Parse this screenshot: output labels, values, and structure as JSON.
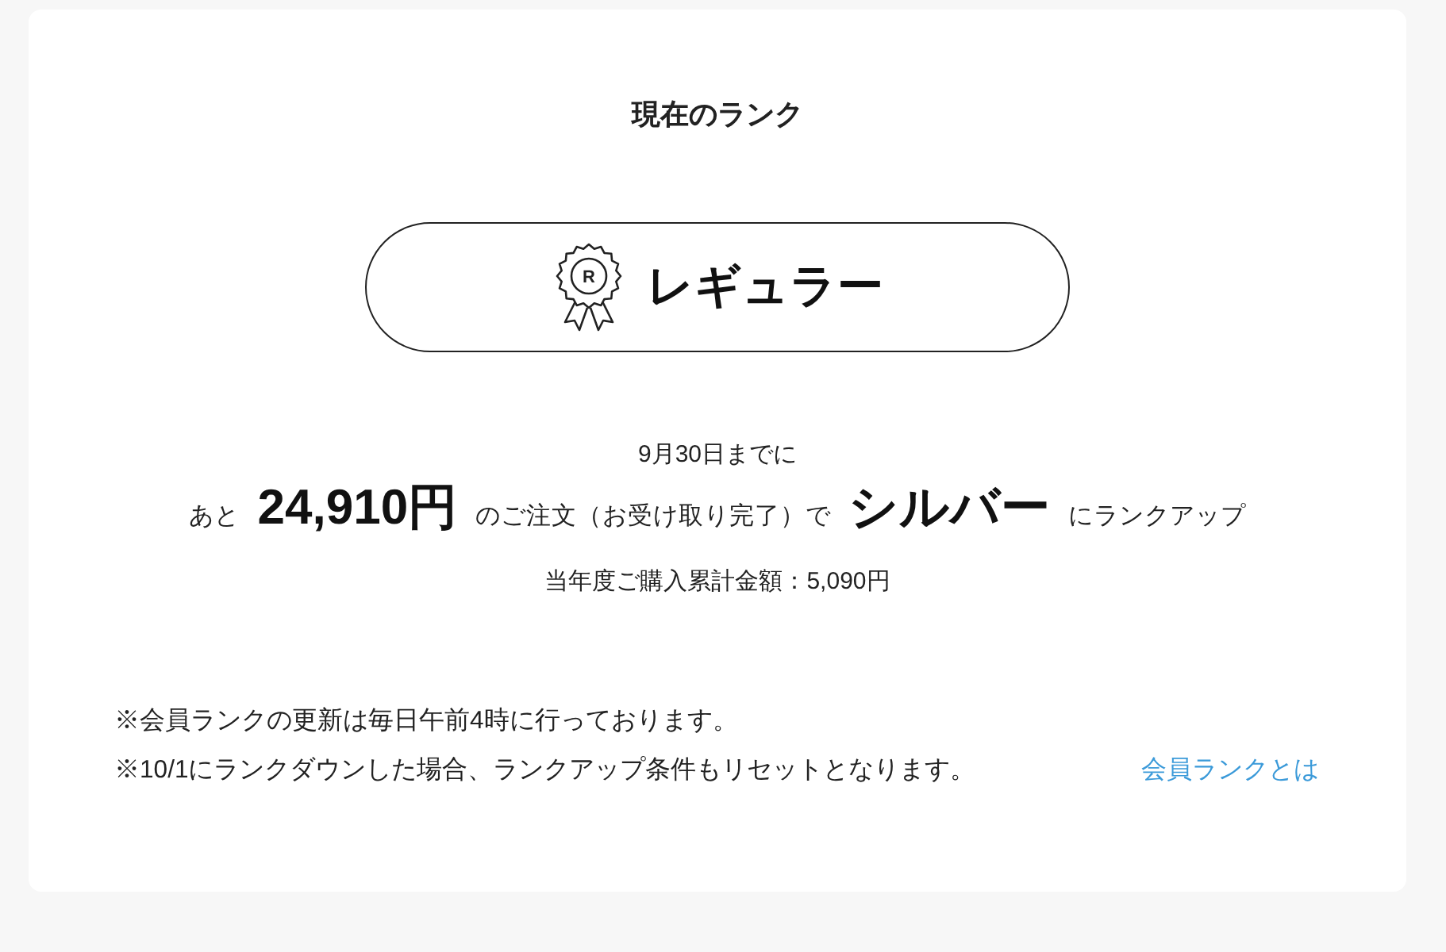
{
  "title": "現在のランク",
  "current_rank": {
    "badge_letter": "R",
    "name": "レギュラー"
  },
  "progress": {
    "deadline": "9月30日までに",
    "message": "あと **24,910円** のご注文（お受け取り完了）で **シルバー** にランクアップ",
    "total": "当年度ご購入累計金額：5,090円"
  },
  "notes": [
    "※会員ランクの更新は毎日午前4時に行っております。",
    "※10/1にランクダウンした場合、ランクアップ条件もリセットとなります。"
  ],
  "link": "会員ランクとは"
}
